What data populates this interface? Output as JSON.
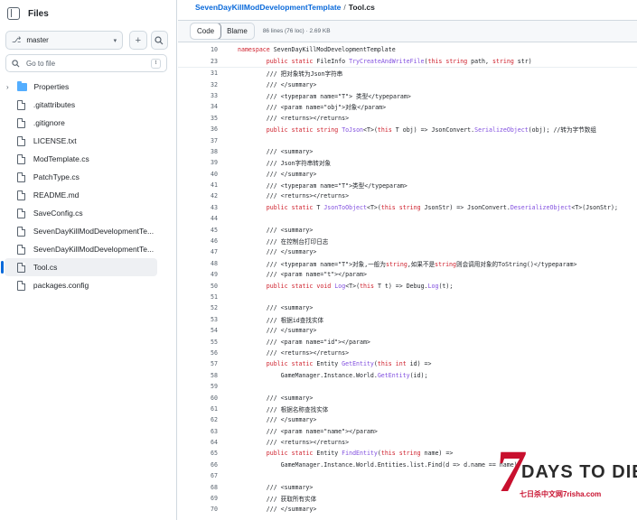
{
  "sidebar": {
    "title": "Files",
    "branch": "master",
    "search_placeholder": "Go to file",
    "search_shortcut": "t",
    "items": [
      {
        "label": "Properties",
        "type": "folder"
      },
      {
        "label": ".gitattributes",
        "type": "file"
      },
      {
        "label": ".gitignore",
        "type": "file"
      },
      {
        "label": "LICENSE.txt",
        "type": "file"
      },
      {
        "label": "ModTemplate.cs",
        "type": "file"
      },
      {
        "label": "PatchType.cs",
        "type": "file"
      },
      {
        "label": "README.md",
        "type": "file"
      },
      {
        "label": "SaveConfig.cs",
        "type": "file"
      },
      {
        "label": "SevenDayKillModDevelopmentTe...",
        "type": "file"
      },
      {
        "label": "SevenDayKillModDevelopmentTe...",
        "type": "file"
      },
      {
        "label": "Tool.cs",
        "type": "file",
        "active": true
      },
      {
        "label": "packages.config",
        "type": "file"
      }
    ]
  },
  "breadcrumb": {
    "repo": "SevenDayKillModDevelopmentTemplate",
    "separator": "/",
    "file": "Tool.cs"
  },
  "toolbar": {
    "code_label": "Code",
    "blame_label": "Blame",
    "meta": "86 lines (76 loc) · 2.69 KB"
  },
  "code": {
    "sticky": [
      {
        "n": "10",
        "t": "namespace SevenDayKillModDevelopmentTemplate"
      },
      {
        "n": "23",
        "t": "        public static FileInfo TryCreateAndWriteFile(this string path, string str)"
      }
    ],
    "lines": [
      {
        "n": "31",
        "t": "        /// 把对象转为Json字符串"
      },
      {
        "n": "32",
        "t": "        /// </summary>"
      },
      {
        "n": "33",
        "t": "        /// <typeparam name=\"T\"> 类型</typeparam>"
      },
      {
        "n": "34",
        "t": "        /// <param name=\"obj\">对象</param>"
      },
      {
        "n": "35",
        "t": "        /// <returns></returns>"
      },
      {
        "n": "36",
        "t": "        public static string ToJson<T>(this T obj) => JsonConvert.SerializeObject(obj); //转为字节数组"
      },
      {
        "n": "37",
        "t": ""
      },
      {
        "n": "38",
        "t": "        /// <summary>"
      },
      {
        "n": "39",
        "t": "        /// Json字符串转对象"
      },
      {
        "n": "40",
        "t": "        /// </summary>"
      },
      {
        "n": "41",
        "t": "        /// <typeparam name=\"T\">类型</typeparam>"
      },
      {
        "n": "42",
        "t": "        /// <returns></returns>"
      },
      {
        "n": "43",
        "t": "        public static T JsonToObject<T>(this string JsonStr) => JsonConvert.DeserializeObject<T>(JsonStr);"
      },
      {
        "n": "44",
        "t": ""
      },
      {
        "n": "45",
        "t": "        /// <summary>"
      },
      {
        "n": "46",
        "t": "        /// 在控制台打印日志"
      },
      {
        "n": "47",
        "t": "        /// </summary>"
      },
      {
        "n": "48",
        "t": "        /// <typeparam name=\"T\">对象,一般为string,如果不是string则会调用对象的ToString()</typeparam>"
      },
      {
        "n": "49",
        "t": "        /// <param name=\"t\"></param>"
      },
      {
        "n": "50",
        "t": "        public static void Log<T>(this T t) => Debug.Log(t);"
      },
      {
        "n": "51",
        "t": ""
      },
      {
        "n": "52",
        "t": "        /// <summary>"
      },
      {
        "n": "53",
        "t": "        /// 根据id查找实体"
      },
      {
        "n": "54",
        "t": "        /// </summary>"
      },
      {
        "n": "55",
        "t": "        /// <param name=\"id\"></param>"
      },
      {
        "n": "56",
        "t": "        /// <returns></returns>"
      },
      {
        "n": "57",
        "t": "        public static Entity GetEntity(this int id) =>"
      },
      {
        "n": "58",
        "t": "            GameManager.Instance.World.GetEntity(id);"
      },
      {
        "n": "59",
        "t": ""
      },
      {
        "n": "60",
        "t": "        /// <summary>"
      },
      {
        "n": "61",
        "t": "        /// 根据名称查找实体"
      },
      {
        "n": "62",
        "t": "        /// </summary>"
      },
      {
        "n": "63",
        "t": "        /// <param name=\"name\"></param>"
      },
      {
        "n": "64",
        "t": "        /// <returns></returns>"
      },
      {
        "n": "65",
        "t": "        public static Entity FindEntity(this string name) =>"
      },
      {
        "n": "66",
        "t": "            GameManager.Instance.World.Entities.list.Find(d => d.name == name);"
      },
      {
        "n": "67",
        "t": ""
      },
      {
        "n": "68",
        "t": "        /// <summary>"
      },
      {
        "n": "69",
        "t": "        /// 获取所有实体"
      },
      {
        "n": "70",
        "t": "        /// </summary>"
      }
    ]
  },
  "watermark": {
    "seven": "7",
    "title": "DAYS TO DIE",
    "subtitle": "七日杀中文网7risha.com"
  }
}
